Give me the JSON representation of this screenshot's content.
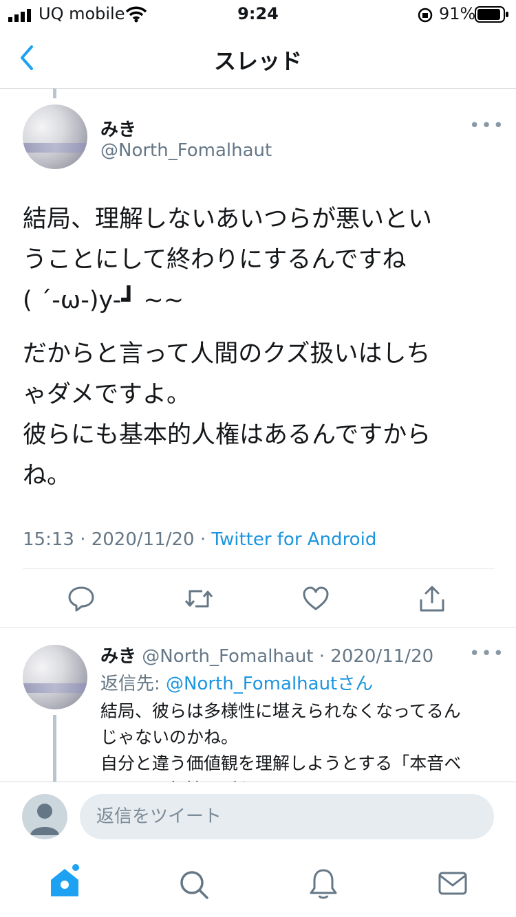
{
  "status_bar": {
    "carrier": "UQ mobile",
    "time": "9:24",
    "battery": "91%"
  },
  "nav": {
    "title": "スレッド",
    "back_icon": "chevron-left-icon"
  },
  "tweet": {
    "name": "みき",
    "handle": "@North_Fomalhaut",
    "paragraph1": "結局、理解しないあいつらが悪いとい\nうことにして終わりにするんですね\n( ´-ω-)y-┛ ~~",
    "paragraph2": "だからと言って人間のクズ扱いはしち\nゃダメですよ。\n彼らにも基本的人権はあるんですから\nね。",
    "time": "15:13 · 2020/11/20 · ",
    "source": "Twitter for Android",
    "actions": [
      "reply-icon",
      "retweet-icon",
      "like-icon",
      "share-icon"
    ]
  },
  "reply_tweet": {
    "name": "みき",
    "handle_date": "@North_Fomalhaut · 2020/11/20",
    "replying_prefix": "返信先: ",
    "replying_to": "@North_Fomalhautさん",
    "text": "結局、彼らは多様性に堪えられなくなってるん\nじゃないのかね。\n自分と違う価値観を理解しようとする「本音ベ\nース」の気持ちがないじゃん"
  },
  "composer": {
    "placeholder": "返信をツイート"
  },
  "tab_bar": {
    "items": [
      "home-icon",
      "search-icon",
      "notifications-icon",
      "messages-icon"
    ],
    "accent": "#1da1f2"
  },
  "colors": {
    "accent": "#1da1f2",
    "link": "#1b95e0",
    "secondary_text": "#657786"
  }
}
